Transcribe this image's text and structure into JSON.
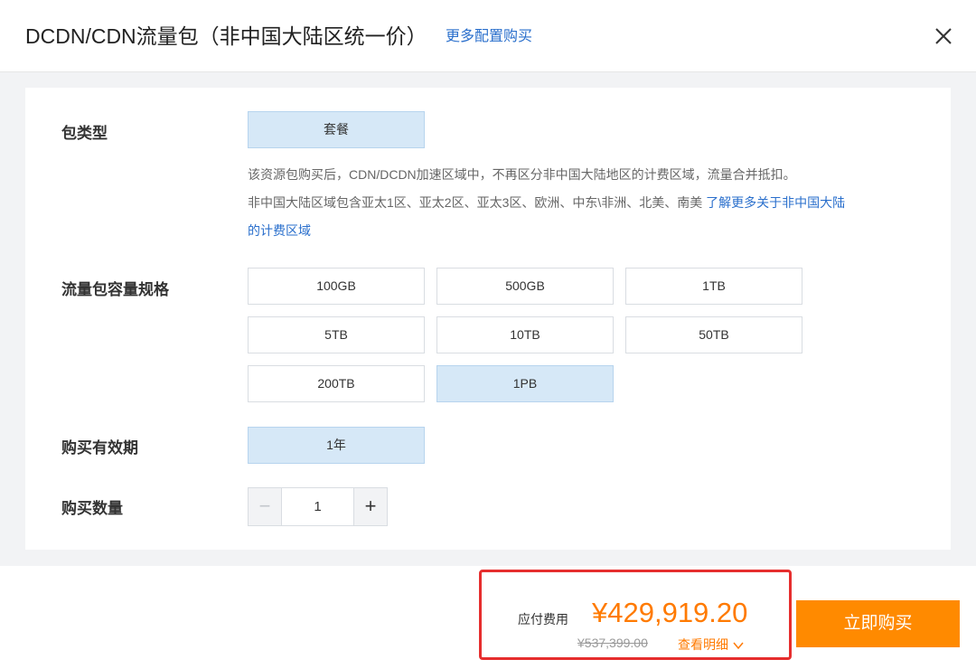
{
  "header": {
    "title": "DCDN/CDN流量包（非中国大陆区统一价）",
    "more_link": "更多配置购买",
    "close_icon": "close-icon"
  },
  "package_type": {
    "label": "包类型",
    "options": [
      {
        "label": "套餐",
        "selected": true
      }
    ],
    "desc_line1": "该资源包购买后，CDN/DCDN加速区域中，不再区分非中国大陆地区的计费区域，流量合并抵扣。",
    "desc_line2": "非中国大陆区域包含亚太1区、亚太2区、亚太3区、欧洲、中东\\非洲、北美、南美",
    "desc_link_part1": "了解更多关于非中国大陆",
    "desc_link_part2": "的计费区域"
  },
  "capacity": {
    "label": "流量包容量规格",
    "options": [
      {
        "label": "100GB",
        "selected": false
      },
      {
        "label": "500GB",
        "selected": false
      },
      {
        "label": "1TB",
        "selected": false
      },
      {
        "label": "5TB",
        "selected": false
      },
      {
        "label": "10TB",
        "selected": false
      },
      {
        "label": "50TB",
        "selected": false
      },
      {
        "label": "200TB",
        "selected": false
      },
      {
        "label": "1PB",
        "selected": true
      }
    ]
  },
  "validity": {
    "label": "购买有效期",
    "options": [
      {
        "label": "1年",
        "selected": true
      }
    ]
  },
  "quantity": {
    "label": "购买数量",
    "value": "1",
    "minus": "−",
    "plus": "+"
  },
  "footer": {
    "price_label": "应付费用",
    "price": "¥429,919.20",
    "original_price": "¥537,399.00",
    "detail_link": "查看明细",
    "buy_button": "立即购买",
    "accent_color": "#ff8a00",
    "highlight_border_color": "#e62e2e"
  }
}
